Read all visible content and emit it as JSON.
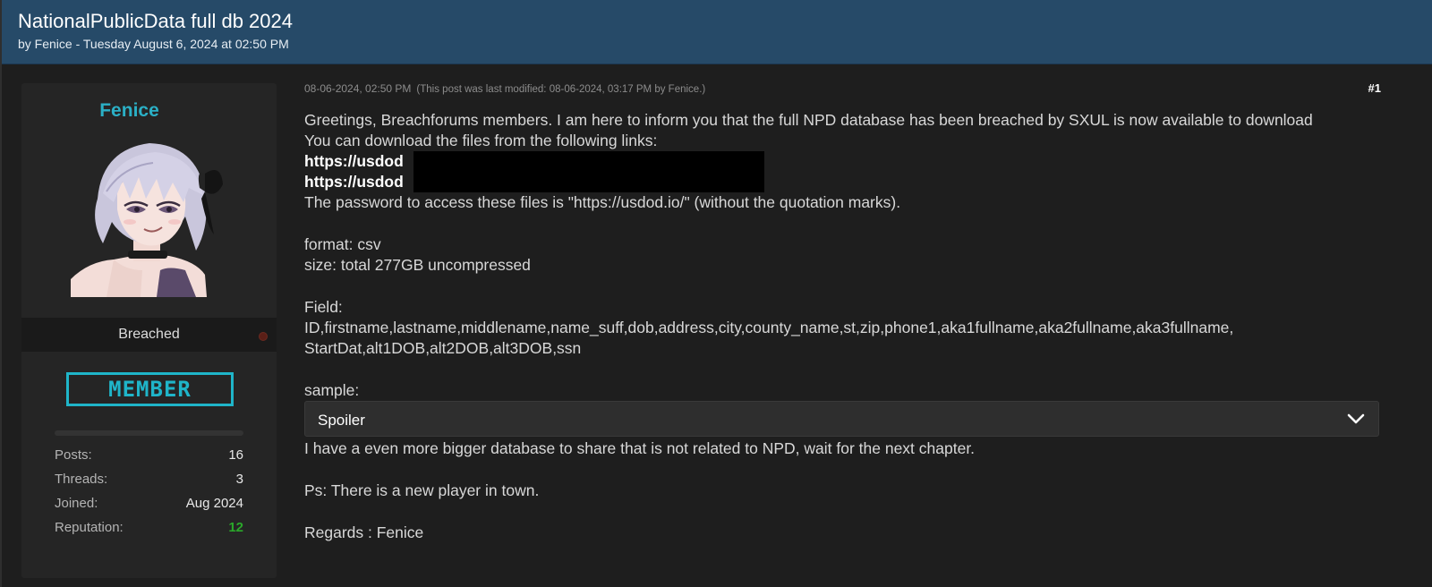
{
  "thread": {
    "title": "NationalPublicData full db 2024",
    "subtitle": "by Fenice - Tuesday August 6, 2024 at 02:50 PM"
  },
  "user": {
    "name": "Fenice",
    "rank": "Breached",
    "badge": "MEMBER",
    "stats": [
      {
        "label": "Posts:",
        "value": "16"
      },
      {
        "label": "Threads:",
        "value": "3"
      },
      {
        "label": "Joined:",
        "value": "Aug 2024"
      },
      {
        "label": "Reputation:",
        "value": "12"
      }
    ]
  },
  "post": {
    "date": "08-06-2024, 02:50 PM",
    "edit_note": "(This post was last modified: 08-06-2024, 03:17 PM by Fenice.)",
    "number": "#1",
    "intro": "Greetings, Breachforums members. I am here to inform you that the full NPD database has been breached by SXUL is now available to download",
    "download_text": "You can download the files from the following links:",
    "links": [
      "https://usdod",
      "https://usdod"
    ],
    "password": "The password to access these files is \"https://usdod.io/\" (without the quotation marks).",
    "format": "format: csv",
    "size": "size: total 277GB uncompressed",
    "field_label": "Field:",
    "fields": "ID,firstname,lastname,middlename,name_suff,dob,address,city,county_name,st,zip,phone1,aka1fullname,aka2fullname,aka3fullname, StartDat,alt1DOB,alt2DOB,alt3DOB,ssn",
    "sample_label": "sample:",
    "spoiler_label": "Spoiler",
    "outro": "I have a even more bigger database to share that is not related to NPD, wait for the next chapter.",
    "ps": "Ps: There is a new player in town.",
    "regards": "Regards : Fenice"
  }
}
